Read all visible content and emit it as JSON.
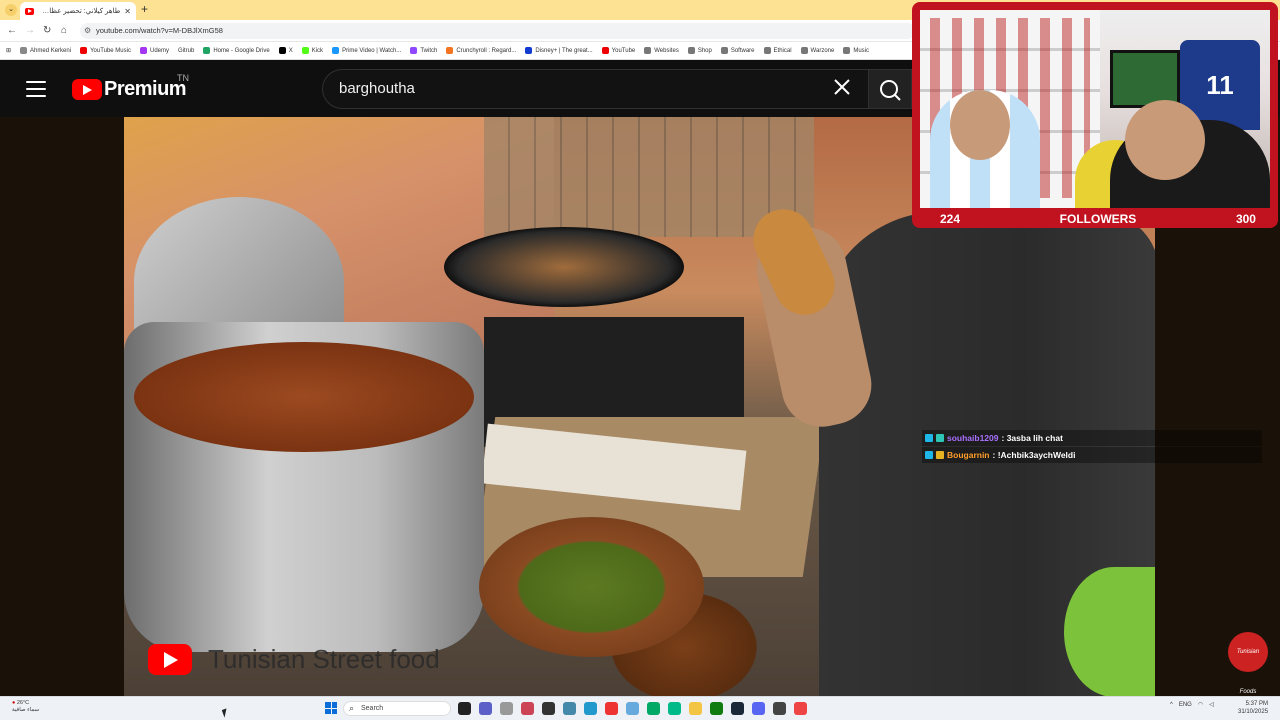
{
  "browser": {
    "tab_title": "طاهر كيلاني: تحضير عظام نعت...",
    "new_tab_label": "+",
    "url": "youtube.com/watch?v=M-DBJlXmG58",
    "bookmarks": [
      "Ahmed Kerkeni",
      "YouTube Music",
      "Udemy",
      "Gitrub",
      "Home - Google Drive",
      "X",
      "Kick",
      "Prime Video | Watch...",
      "Twitch",
      "Crunchyroll : Regard...",
      "Disney+ | The great...",
      "YouTube",
      "Websites",
      "Shop",
      "Software",
      "Ethical",
      "Warzone",
      "Music"
    ]
  },
  "youtube": {
    "logo_text": "Premium",
    "logo_sup": "TN",
    "search_value": "barghoutha"
  },
  "video": {
    "watermark_text": "Tunisian Street food",
    "channel_badge": "Tunisian Foods"
  },
  "chat": [
    {
      "user": "souhaib1209",
      "message": ": 3asba lih chat",
      "color": "#a970ff"
    },
    {
      "user": "Bougarnin",
      "message": ": !Achbik3aychWeldi",
      "color": "#ff9f2a"
    }
  ],
  "webcam": {
    "jersey_number": "11",
    "followers_current": "224",
    "followers_label": "FOLLOWERS",
    "followers_goal": "300",
    "frame_color": "#c1121f"
  },
  "taskbar": {
    "weather_temp": "26°C",
    "weather_desc": "سماء صافية",
    "search_placeholder": "Search",
    "lang": "ENG",
    "time": "5:37 PM",
    "date": "31/10/2025"
  }
}
